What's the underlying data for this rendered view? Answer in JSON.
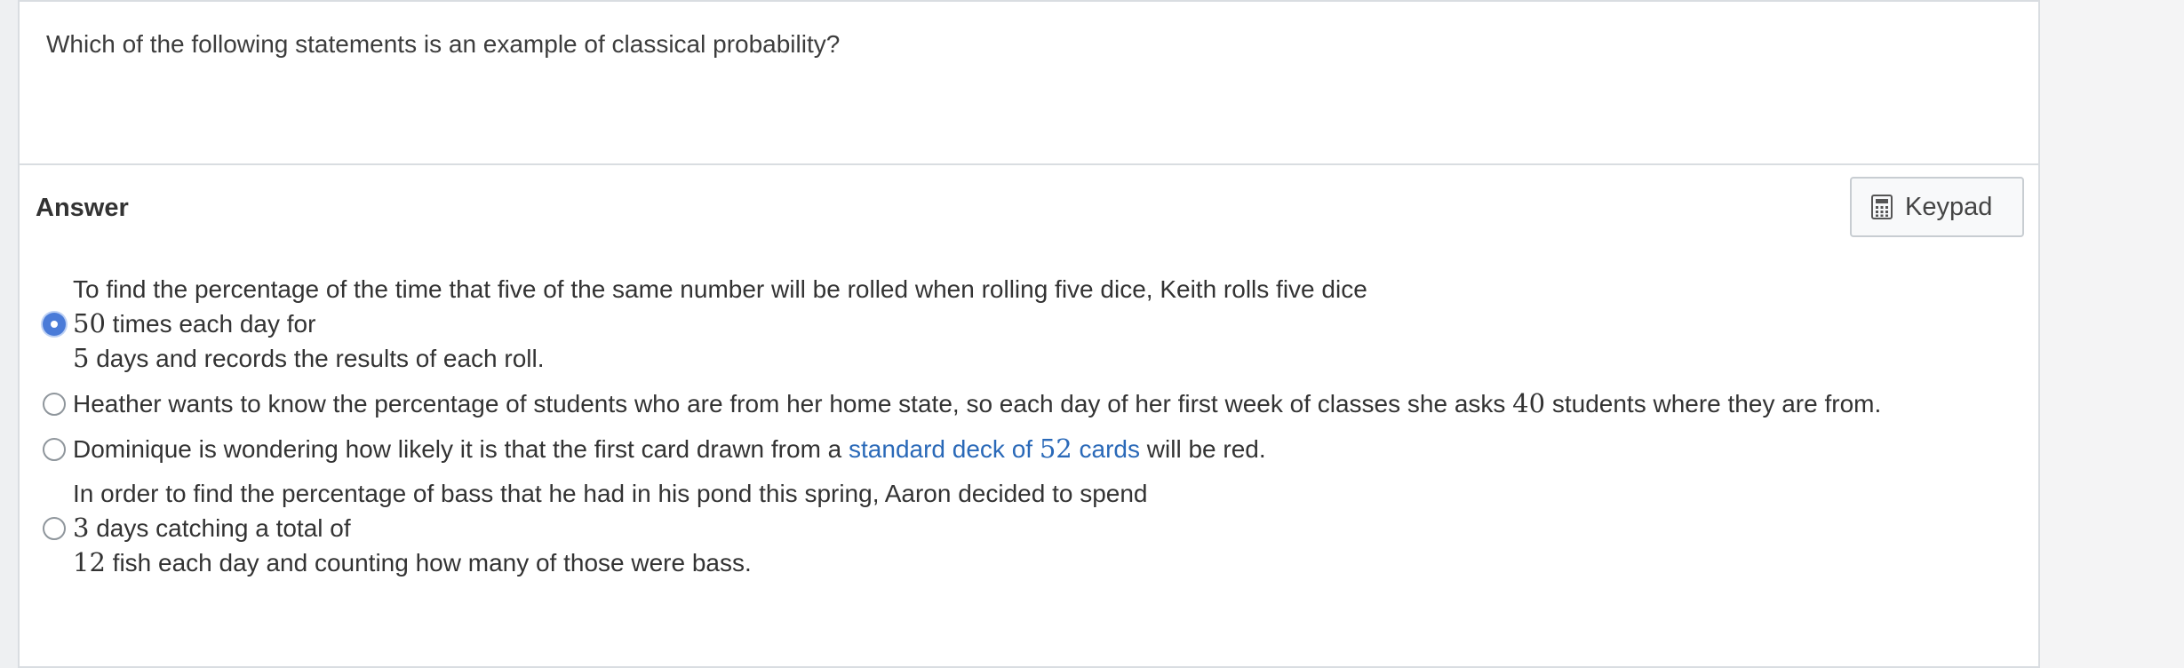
{
  "question": {
    "text": "Which of the following statements is an example of classical probability?"
  },
  "answer": {
    "heading": "Answer",
    "keypad_label": "Keypad",
    "options": [
      {
        "selected": true,
        "line1": "To find the percentage of the time that five of the same number will be rolled when rolling five dice, Keith rolls five dice",
        "line2_num": "50",
        "line2_text": " times each day for",
        "line3_num": "5",
        "line3_text": " days and records the results of each roll."
      },
      {
        "selected": false,
        "text_before": "Heather wants to know the percentage of students who are from her home state, so each day of her first week of classes she asks ",
        "num": "40",
        "text_after": " students where they are from."
      },
      {
        "selected": false,
        "text_before": "Dominique is wondering how likely it is that the first card drawn from a ",
        "link_before": "standard deck of ",
        "link_num": "52",
        "link_after": " cards",
        "text_after": " will be red."
      },
      {
        "selected": false,
        "line1": "In order to find the percentage of bass that he had in his pond this spring, Aaron decided to spend",
        "line2_num": "3",
        "line2_text": " days catching a total of",
        "line3_num": "12",
        "line3_text": " fish each day and counting how many of those were bass."
      }
    ]
  },
  "colors": {
    "radio_selected": "#4a7bd8",
    "link": "#2a69b8",
    "border": "#d9dde1"
  },
  "icons": {
    "keypad": "calculator-icon"
  }
}
